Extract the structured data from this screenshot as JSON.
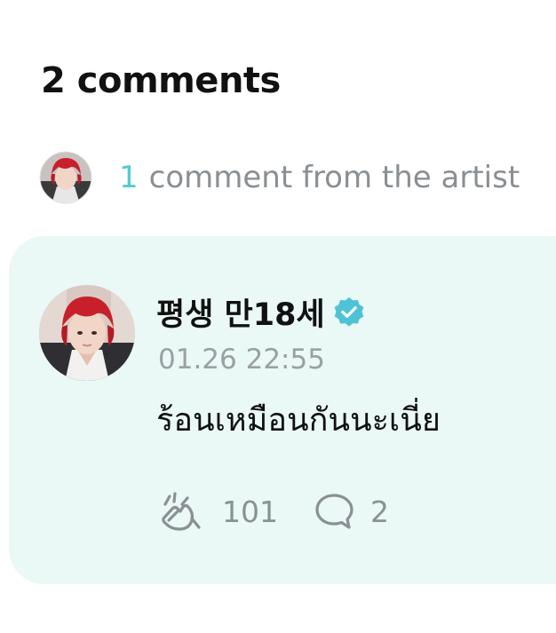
{
  "comments_header": {
    "title": "2 comments"
  },
  "artist_comments": {
    "count": "1",
    "label": "comment from the artist"
  },
  "comment": {
    "author": "평생 만18세",
    "verified": true,
    "timestamp": "01.26 22:55",
    "body": "ร้อนเหมือนกันนะเนี่ย",
    "like_icon": "clap-icon",
    "likes": "101",
    "reply_icon": "speech-bubble-icon",
    "replies": "2"
  },
  "colors": {
    "accent": "#55c9d4",
    "card_background": "#eaf8f6",
    "verified_badge": "#4fc3d5",
    "muted_text": "#8a9094"
  }
}
